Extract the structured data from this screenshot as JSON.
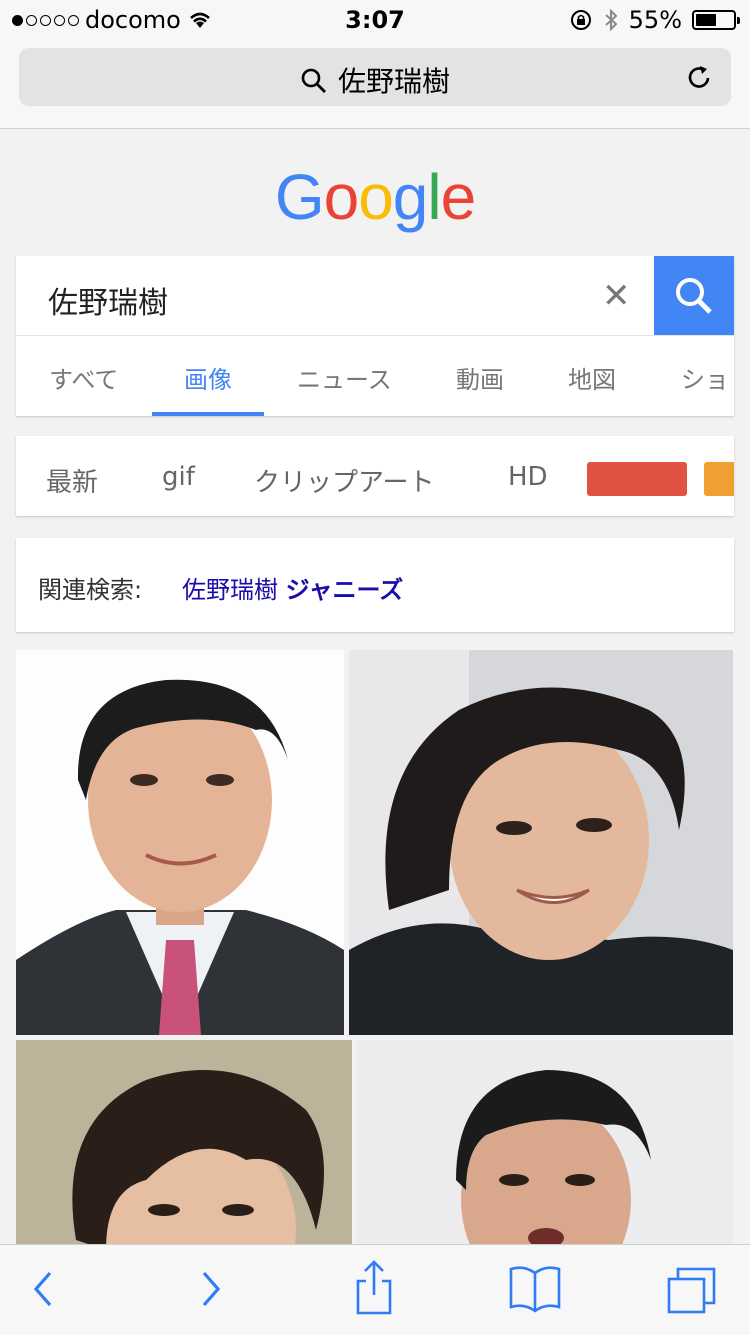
{
  "status_bar": {
    "carrier": "docomo",
    "time": "3:07",
    "battery": "55%",
    "battery_level": 0.55,
    "signal_bars": 1
  },
  "browser": {
    "url_text": "佐野瑞樹"
  },
  "google": {
    "logo_letters": [
      "G",
      "o",
      "o",
      "g",
      "l",
      "e"
    ],
    "logo_colors": [
      "#4285f4",
      "#ea4335",
      "#fbbc05",
      "#4285f4",
      "#34a853",
      "#ea4335"
    ],
    "query": "佐野瑞樹",
    "tabs": [
      "すべて",
      "画像",
      "ニュース",
      "動画",
      "地図",
      "ショ"
    ],
    "active_tab": "画像",
    "filters": [
      "最新",
      "gif",
      "クリップアート",
      "HD"
    ],
    "color_chips": [
      "#e05242",
      "#f0a030"
    ],
    "related_label": "関連検索:",
    "related_link_plain": "佐野瑞樹",
    "related_link_bold": "ジャニーズ"
  },
  "colors": {
    "accent": "#4285f4",
    "link": "#1a0dab",
    "ios_blue": "#2f7cf6"
  },
  "toolbar": {
    "icons": [
      "back-icon",
      "forward-icon",
      "share-icon",
      "bookmarks-icon",
      "tabs-icon"
    ]
  }
}
